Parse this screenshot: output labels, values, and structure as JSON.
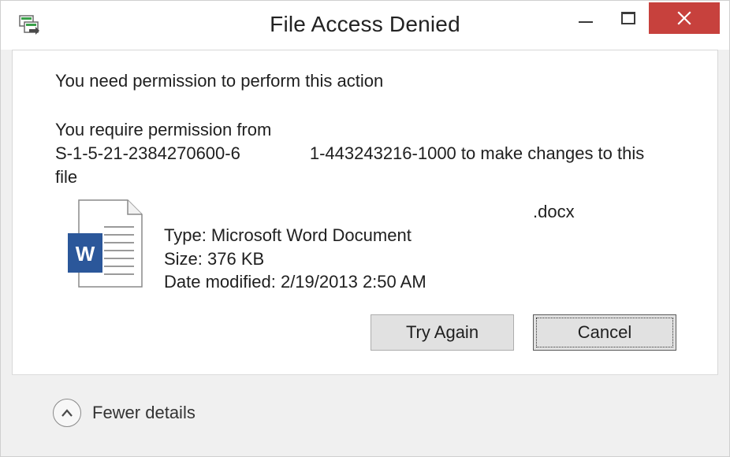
{
  "window": {
    "title": "File Access Denied",
    "icons": {
      "app": "file-transfer-icon",
      "minimize": "minimize-icon",
      "maximize": "maximize-icon",
      "close": "close-icon"
    },
    "close_color": "#c7413d"
  },
  "message": {
    "heading": "You need permission to perform this action",
    "permission_line1": "You require permission from",
    "permission_sid_start": "S-1-5-21-2384270600-6",
    "permission_sid_end": "1-443243216-1000 to make changes to this",
    "permission_line3": "file"
  },
  "file": {
    "icon": "word-document-icon",
    "icon_letter": "W",
    "icon_color": "#2b579a",
    "name": ".docx",
    "type": "Type: Microsoft Word Document",
    "size": "Size: 376 KB",
    "modified": "Date modified: 2/19/2013 2:50 AM"
  },
  "buttons": {
    "try_again": "Try Again",
    "cancel": "Cancel"
  },
  "footer": {
    "toggle_label": "Fewer details",
    "toggle_icon": "chevron-up-icon"
  }
}
